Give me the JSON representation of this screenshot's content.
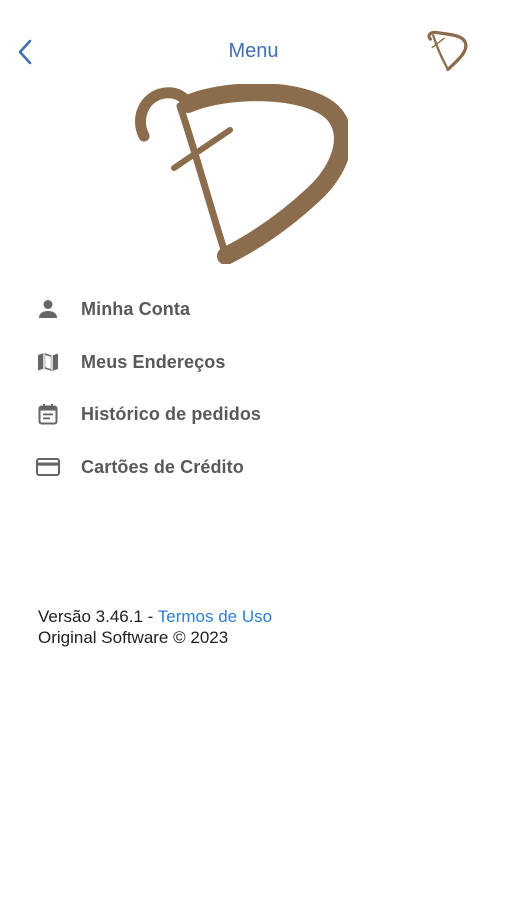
{
  "nav": {
    "title": "Menu",
    "back_icon": "chevron-left-icon",
    "logo_icon": "brand-monogram-logo",
    "accent_color": "#3f6fb5"
  },
  "brand": {
    "logo_color": "#8b6c4d"
  },
  "menu": {
    "items": [
      {
        "label": "Minha Conta",
        "icon": "person-icon"
      },
      {
        "label": "Meus Endereços",
        "icon": "map-icon"
      },
      {
        "label": "Histórico de pedidos",
        "icon": "calendar-icon"
      },
      {
        "label": "Cartões de Crédito",
        "icon": "credit-card-icon"
      }
    ]
  },
  "footer": {
    "version_text": "Versão 3.46.1 -",
    "terms_link": "Termos de Uso",
    "copyright": "Original Software © 2023",
    "link_color": "#2d7fd8"
  }
}
